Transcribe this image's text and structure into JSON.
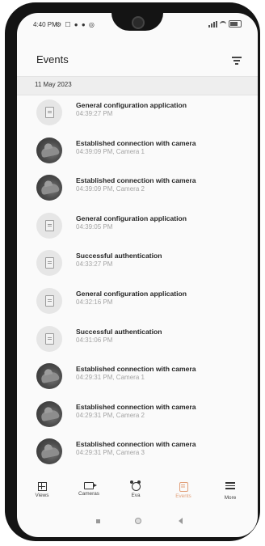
{
  "status_bar": {
    "time": "4:40 PM",
    "left_icons": "⚙ ☐ ● ● ◎"
  },
  "header": {
    "title": "Events",
    "filter_icon": "filter-icon"
  },
  "date": "11 May 2023",
  "events": [
    {
      "title": "General configuration application",
      "sub": "04:39:27 PM",
      "thumb": "document-icon"
    },
    {
      "title": "Established connection with camera",
      "sub": "04:39:09 PM, Camera 1",
      "thumb": "camera-snapshot"
    },
    {
      "title": "Established connection with camera",
      "sub": "04:39:09 PM, Camera 2",
      "thumb": "camera-snapshot"
    },
    {
      "title": "General configuration application",
      "sub": "04:39:05 PM",
      "thumb": "document-icon"
    },
    {
      "title": "Successful authentication",
      "sub": "04:33:27 PM",
      "thumb": "document-icon"
    },
    {
      "title": "General configuration application",
      "sub": "04:32:16 PM",
      "thumb": "document-icon"
    },
    {
      "title": "Successful authentication",
      "sub": "04:31:06 PM",
      "thumb": "document-icon"
    },
    {
      "title": "Established connection with camera",
      "sub": "04:29:31 PM, Camera 1",
      "thumb": "camera-snapshot"
    },
    {
      "title": "Established connection with camera",
      "sub": "04:29:31 PM, Camera 2",
      "thumb": "camera-snapshot"
    },
    {
      "title": "Established connection with camera",
      "sub": "04:29:31 PM, Camera 3",
      "thumb": "camera-snapshot"
    }
  ],
  "bottom_nav": [
    {
      "label": "Views",
      "icon": "grid-icon"
    },
    {
      "label": "Cameras",
      "icon": "camera-icon"
    },
    {
      "label": "Eva",
      "icon": "alarm-clock-icon"
    },
    {
      "label": "Events",
      "icon": "events-icon",
      "active": true
    },
    {
      "label": "More",
      "icon": "menu-icon"
    }
  ],
  "colors": {
    "accent": "#e1a07a",
    "date_bar_bg": "#eeeeee",
    "title_text": "#262626",
    "subtitle_text": "#a3a3a3"
  }
}
